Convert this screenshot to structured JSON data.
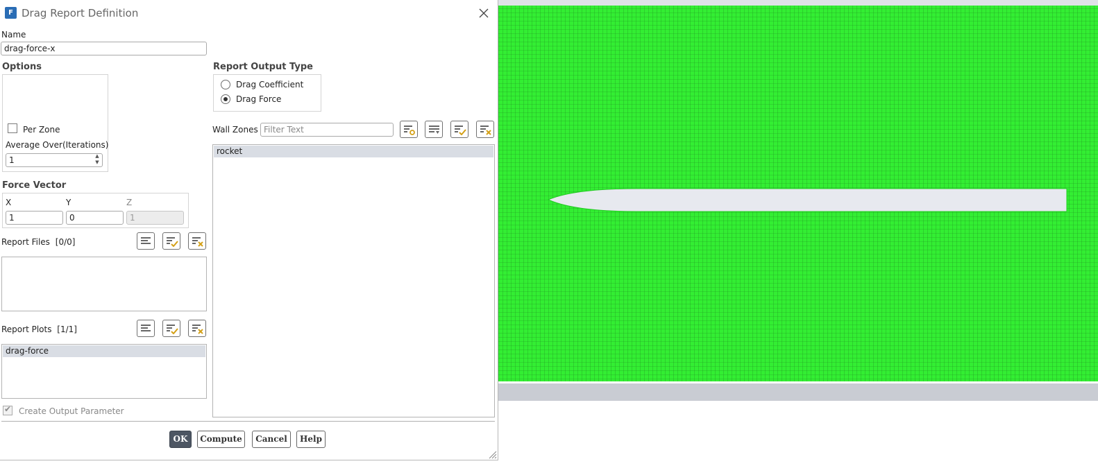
{
  "dialog": {
    "title": "Drag Report Definition",
    "name_label": "Name",
    "name_value": "drag-force-x"
  },
  "options": {
    "heading": "Options",
    "per_zone_label": "Per Zone",
    "per_zone_checked": false,
    "average_over_label": "Average Over(Iterations)",
    "average_over_value": "1"
  },
  "force_vector": {
    "heading": "Force Vector",
    "x_label": "X",
    "y_label": "Y",
    "z_label": "Z",
    "x_value": "1",
    "y_value": "0",
    "z_value": "1"
  },
  "report_files": {
    "label": "Report Files",
    "count": "[0/0]",
    "items": []
  },
  "report_plots": {
    "label": "Report Plots",
    "count": "[1/1]",
    "items": [
      "drag-force"
    ]
  },
  "create_output_parameter": {
    "label": "Create Output Parameter",
    "checked": true,
    "disabled": true
  },
  "report_output_type": {
    "heading": "Report Output Type",
    "options": [
      "Drag Coefficient",
      "Drag Force"
    ],
    "selected": "Drag Force"
  },
  "wall_zones": {
    "label": "Wall Zones",
    "filter_placeholder": "Filter Text",
    "items": [
      "rocket"
    ]
  },
  "buttons": {
    "ok": "OK",
    "compute": "Compute",
    "cancel": "Cancel",
    "help": "Help"
  },
  "icons": {
    "app": "fluent-app-icon",
    "close": "close-icon",
    "list_all": "list-icon",
    "select_all": "select-all-icon",
    "deselect_all": "deselect-all-icon",
    "filter_match": "filter-match-icon",
    "list_dropdown": "list-dropdown-icon",
    "resize_grip": "resize-grip-icon"
  },
  "colors": {
    "mesh": "#33ee33",
    "selected_item": "#d9dde4",
    "primary_button": "#4d5663",
    "app_icon": "#2a6db5",
    "check_accent": "#d4a017"
  }
}
